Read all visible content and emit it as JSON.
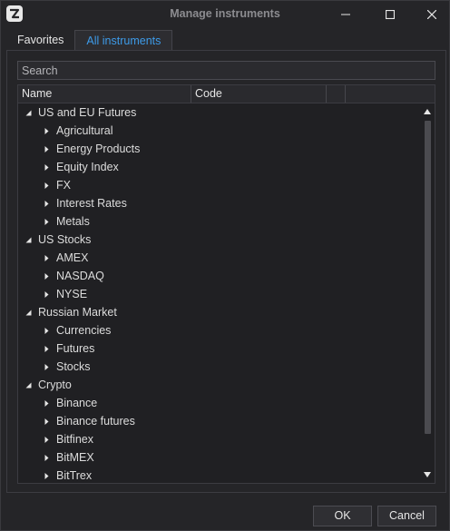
{
  "window": {
    "title": "Manage instruments",
    "colors": {
      "background": "#252528",
      "accent": "#3d9be9",
      "title_text": "#8c8c90"
    }
  },
  "tabs": [
    {
      "label": "Favorites",
      "active": false
    },
    {
      "label": "All instruments",
      "active": true
    }
  ],
  "search": {
    "placeholder": "Search",
    "value": ""
  },
  "grid": {
    "columns": [
      "Name",
      "Code",
      "",
      ""
    ],
    "rows": [
      {
        "label": "US and EU Futures",
        "level": 0,
        "expanded": true
      },
      {
        "label": "Agricultural",
        "level": 1,
        "expanded": false
      },
      {
        "label": "Energy Products",
        "level": 1,
        "expanded": false
      },
      {
        "label": "Equity Index",
        "level": 1,
        "expanded": false
      },
      {
        "label": "FX",
        "level": 1,
        "expanded": false
      },
      {
        "label": "Interest Rates",
        "level": 1,
        "expanded": false
      },
      {
        "label": "Metals",
        "level": 1,
        "expanded": false
      },
      {
        "label": "US Stocks",
        "level": 0,
        "expanded": true
      },
      {
        "label": "AMEX",
        "level": 1,
        "expanded": false
      },
      {
        "label": "NASDAQ",
        "level": 1,
        "expanded": false
      },
      {
        "label": "NYSE",
        "level": 1,
        "expanded": false
      },
      {
        "label": "Russian Market",
        "level": 0,
        "expanded": true
      },
      {
        "label": "Currencies",
        "level": 1,
        "expanded": false
      },
      {
        "label": "Futures",
        "level": 1,
        "expanded": false
      },
      {
        "label": "Stocks",
        "level": 1,
        "expanded": false
      },
      {
        "label": "Crypto",
        "level": 0,
        "expanded": true
      },
      {
        "label": "Binance",
        "level": 1,
        "expanded": false
      },
      {
        "label": "Binance futures",
        "level": 1,
        "expanded": false
      },
      {
        "label": "Bitfinex",
        "level": 1,
        "expanded": false
      },
      {
        "label": "BitMEX",
        "level": 1,
        "expanded": false
      },
      {
        "label": "BitTrex",
        "level": 1,
        "expanded": false
      }
    ]
  },
  "buttons": {
    "ok": "OK",
    "cancel": "Cancel"
  },
  "icons": {
    "app": "app-logo-icon",
    "minimize": "minimize-icon",
    "maximize": "maximize-icon",
    "close": "close-icon",
    "expanded": "triangle-down-icon",
    "collapsed": "triangle-right-icon"
  }
}
